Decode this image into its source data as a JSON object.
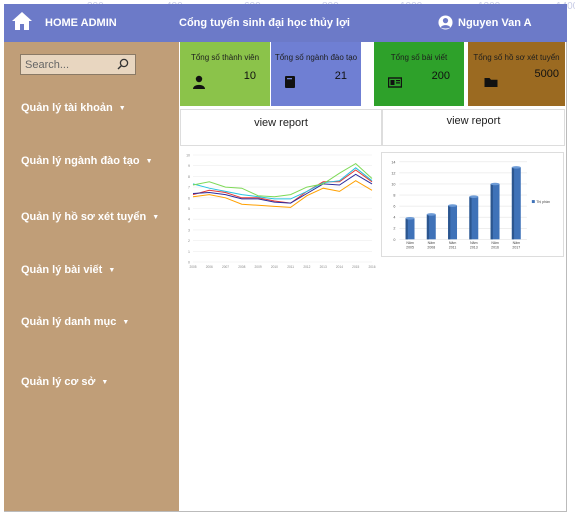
{
  "ruler": [
    "200",
    "400",
    "600",
    "800",
    "1000",
    "1200",
    "1400"
  ],
  "header": {
    "brand": "HOME ADMIN",
    "site_title": "Cổng tuyển sinh đại học thủy lợi",
    "user_name": "Nguyen Van A",
    "background": "#6c7ac8"
  },
  "sidebar": {
    "background": "#c09e78",
    "search_placeholder": "Search...",
    "items": [
      {
        "label": "Quản lý tài khoản"
      },
      {
        "label": "Quản lý ngành đào tạo"
      },
      {
        "label": "Quản lý hồ sơ xét tuyển"
      },
      {
        "label": "Quản lý bài viết"
      },
      {
        "label": "Quản lý danh mục"
      },
      {
        "label": "Quản lý cơ sở"
      }
    ]
  },
  "cards": [
    {
      "label": "Tổng số thành viên",
      "value": "10",
      "color": "#8bc34a",
      "icon": "user-icon"
    },
    {
      "label": "Tổng số ngành đào tạo",
      "value": "21",
      "color": "#6f7fd3",
      "icon": "book-icon"
    },
    {
      "label": "Tổng số bài viết",
      "value": "200",
      "color": "#2ea12a",
      "icon": "newspaper-icon"
    },
    {
      "label": "Tổng số hồ sơ xét tuyển",
      "value": "5000",
      "color": "#9b6a21",
      "icon": "folder-icon"
    }
  ],
  "reports": [
    {
      "label": "view report"
    },
    {
      "label": "view report"
    }
  ],
  "chart_data": [
    {
      "type": "line",
      "ylim": [
        0,
        10
      ],
      "yticks": [
        "0",
        "1",
        "2",
        "3",
        "4",
        "5",
        "6",
        "7",
        "8",
        "9",
        "10"
      ],
      "x": [
        "2005",
        "2006",
        "2007",
        "2008",
        "2009",
        "2010",
        "2011",
        "2012",
        "2013",
        "2014",
        "2015",
        "2016"
      ],
      "series": [
        {
          "color": "#e53935",
          "values": [
            6.3,
            6.7,
            6.5,
            6.0,
            6.0,
            5.7,
            5.5,
            6.6,
            7.5,
            7.5,
            8.6,
            7.5
          ]
        },
        {
          "color": "#2b2b9c",
          "values": [
            6.4,
            6.5,
            6.3,
            5.9,
            5.9,
            5.6,
            5.5,
            6.4,
            7.3,
            7.2,
            8.2,
            7.3
          ]
        },
        {
          "color": "#27c2e0",
          "values": [
            7.3,
            6.9,
            6.6,
            6.3,
            6.1,
            5.9,
            5.9,
            6.6,
            7.4,
            7.6,
            8.8,
            7.6
          ]
        },
        {
          "color": "#7ed957",
          "values": [
            7.2,
            7.5,
            7.0,
            6.9,
            6.2,
            6.1,
            6.3,
            7.0,
            7.3,
            8.3,
            9.2,
            7.8
          ]
        },
        {
          "color": "#ffa000",
          "values": [
            6.1,
            6.3,
            6.0,
            5.4,
            5.3,
            5.2,
            5.1,
            6.2,
            6.9,
            6.6,
            7.6,
            6.7
          ]
        }
      ]
    },
    {
      "type": "bar",
      "ylim": [
        0,
        14
      ],
      "yticks": [
        "0",
        "2",
        "4",
        "6",
        "8",
        "10",
        "12",
        "14"
      ],
      "categories": [
        "Năm 2005",
        "Năm 2008",
        "Năm 2011",
        "Năm 2013",
        "Năm 2016",
        "Năm 2017"
      ],
      "values": [
        3.8,
        4.5,
        6.1,
        7.7,
        10.0,
        13.0
      ],
      "series_name": "Thị phần",
      "color": "#3f72b8"
    }
  ]
}
